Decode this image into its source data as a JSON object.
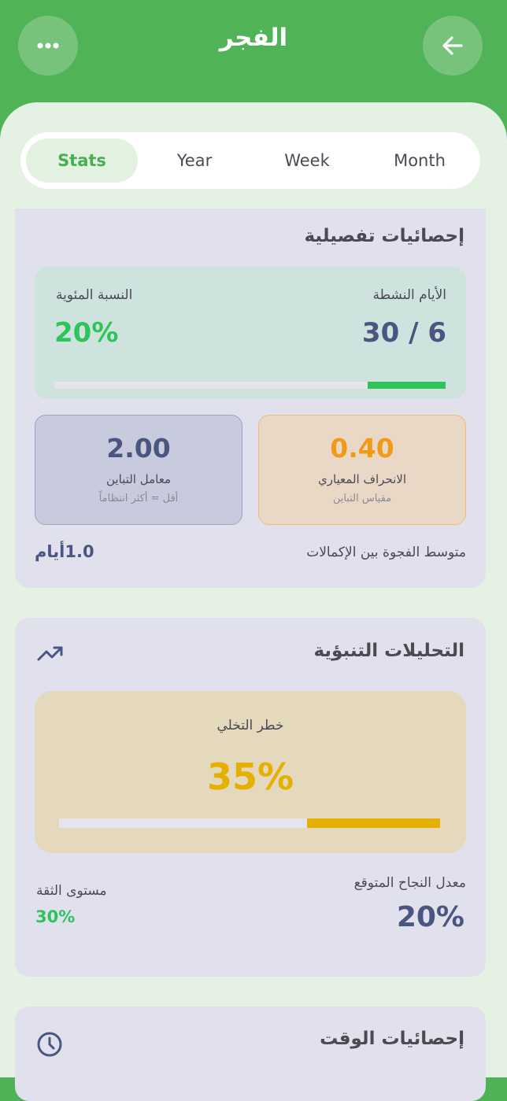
{
  "header": {
    "title": "الفجر",
    "more_icon": "more-dots-icon",
    "back_icon": "arrow-left-icon"
  },
  "tabs": [
    {
      "label": "Stats",
      "active": true
    },
    {
      "label": "Year",
      "active": false
    },
    {
      "label": "Week",
      "active": false
    },
    {
      "label": "Month",
      "active": false
    }
  ],
  "detailed": {
    "title": "إحصائيات تفصيلية",
    "active_days_label": "الأيام النشطة",
    "active_days_value": "30 / 6",
    "percent_label": "النسبة المئوية",
    "percent_value": "20%",
    "progress_fraction": 0.2,
    "std_dev": {
      "value": "0.40",
      "label": "الانحراف المعياري",
      "sub": "مقياس التباين"
    },
    "cv": {
      "value": "2.00",
      "label": "معامل التباين",
      "sub": "أقل = أكثر انتظاماً"
    },
    "gap_label": "متوسط الفجوة بين الإكمالات",
    "gap_value": "1.0أيام"
  },
  "predictive": {
    "title": "التحليلات التنبؤية",
    "trend_icon": "trending-up-icon",
    "risk_label": "خطر التخلي",
    "risk_value": "35%",
    "risk_fraction": 0.35,
    "success_label": "معدل النجاح المتوقع",
    "success_value": "20%",
    "confidence_label": "مستوى الثقة",
    "confidence_value": "30%"
  },
  "time": {
    "title": "إحصائيات الوقت",
    "clock_icon": "clock-icon"
  },
  "colors": {
    "brand_green": "#51b358",
    "progress_green": "#2ec45a",
    "navy": "#4a5580",
    "orange": "#f29a17",
    "risk_yellow": "#e6b000"
  }
}
